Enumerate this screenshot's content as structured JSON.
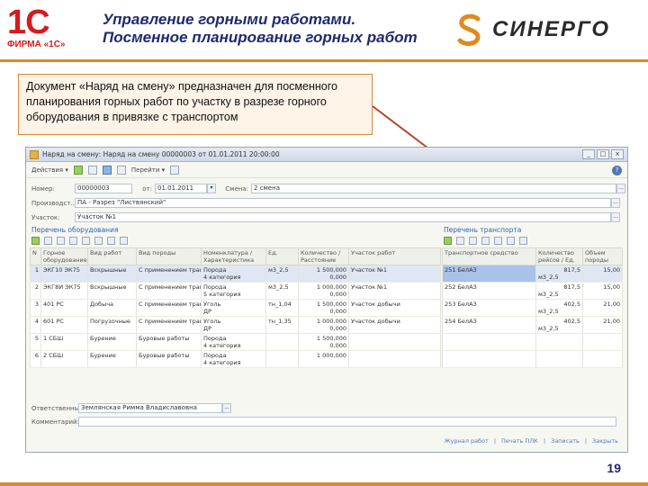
{
  "slide": {
    "logo_1c_mark": "1С",
    "logo_1c_caption": "ФИРМА «1С»",
    "title_line1": "Управление горными работами.",
    "title_line2": "Посменное планирование горных работ",
    "sinergo_word": "СИНЕРГО",
    "callout_text": "Документ «Наряд на смену» предназначен для посменного планирования горных работ по участку в разрезе горного оборудования в привязке с транспортом",
    "page_number": "19",
    "colors": {
      "title": "#1f2a6b",
      "accent": "#d98a2b",
      "logo_red": "#d61a1f",
      "callout_border": "#d48a3a"
    }
  },
  "window": {
    "title": "Наряд на смену: Наряд на смену 00000003 от 01.01.2011 20:00:00",
    "toolbar": {
      "actions": "Действия ▾",
      "goto": "Перейти ▾"
    },
    "form": {
      "number_label": "Номер:",
      "number_value": "00000003",
      "date_label": "от:",
      "date_value": "01.01.2011",
      "shift_label": "Смена:",
      "shift_value": "2 смена",
      "production_label": "Производст...:",
      "production_value": "ПА - Разрез \"Листвянский\"",
      "section_label": "Участок:",
      "section_value": "Участок №1"
    },
    "equipment": {
      "title": "Перечень оборудования",
      "columns": [
        "N",
        "Горное оборудование",
        "Вид работ",
        "Вид породы",
        "Номенклатура / Характеристика",
        "Ед.",
        "Количество / Расстояние",
        "Участок работ"
      ],
      "rows": [
        {
          "n": "1",
          "equip": "ЭКГ10 ЭК75",
          "work": "Вскрышные",
          "rock": "С применением транспорта",
          "nom": "Порода",
          "nom2": "4 категория",
          "unit": "м3_2,5",
          "qty": "1 500,000",
          "qty2": "0,000",
          "area": "Участок №1"
        },
        {
          "n": "2",
          "equip": "ЭКГ8И ЭК75",
          "work": "Вскрышные",
          "rock": "С применением транспорта",
          "nom": "Порода",
          "nom2": "5 категория",
          "unit": "м3_2,5",
          "qty": "1 000,000",
          "qty2": "0,000",
          "area": "Участок №1"
        },
        {
          "n": "3",
          "equip": "401 РС",
          "work": "Добыча",
          "rock": "С применением транспорта",
          "nom": "Уголь",
          "nom2": "ДР",
          "unit": "тн_1,04",
          "qty": "1 500,000",
          "qty2": "0,000",
          "area": "Участок добычи"
        },
        {
          "n": "4",
          "equip": "601 РС",
          "work": "Погрузочные",
          "rock": "С применением транспорта",
          "nom": "Уголь",
          "nom2": "ДР",
          "unit": "тн_1,35",
          "qty": "1 000,000",
          "qty2": "0,000",
          "area": "Участок добычи"
        },
        {
          "n": "5",
          "equip": "1 СБШ",
          "work": "Бурение",
          "rock": "Буровые работы",
          "nom": "Порода",
          "nom2": "4 категория",
          "unit": "",
          "qty": "1 500,000",
          "qty2": "0,000",
          "area": ""
        },
        {
          "n": "6",
          "equip": "2 СБШ",
          "work": "Бурение",
          "rock": "Буровые работы",
          "nom": "Порода",
          "nom2": "4 категория",
          "unit": "",
          "qty": "1 000,000",
          "qty2": "",
          "area": ""
        }
      ]
    },
    "transport": {
      "title": "Перечень транспорта",
      "columns": [
        "Транспортное средство",
        "Количество рейсов / Ед.",
        "Объем породы"
      ],
      "rows": [
        {
          "vehicle": "251 БелАЗ",
          "trips": "817,5",
          "unit": "м3_2,5",
          "volume": "15,00"
        },
        {
          "vehicle": "252 БелАЗ",
          "trips": "817,5",
          "unit": "м3_2,5",
          "volume": "15,00"
        },
        {
          "vehicle": "253 БелАЗ",
          "trips": "402,5",
          "unit": "м3_2,5",
          "volume": "21,00"
        },
        {
          "vehicle": "254 БелАЗ",
          "trips": "402,5",
          "unit": "м3_2,5",
          "volume": "21,00"
        }
      ]
    },
    "responsible_label": "Ответственный:",
    "responsible_value": "Землянская Римма Владиславовна",
    "comment_label": "Комментарий:",
    "footer_links": [
      "Журнал работ",
      "Печать ПЛК",
      "Записать",
      "Закрыть"
    ]
  }
}
